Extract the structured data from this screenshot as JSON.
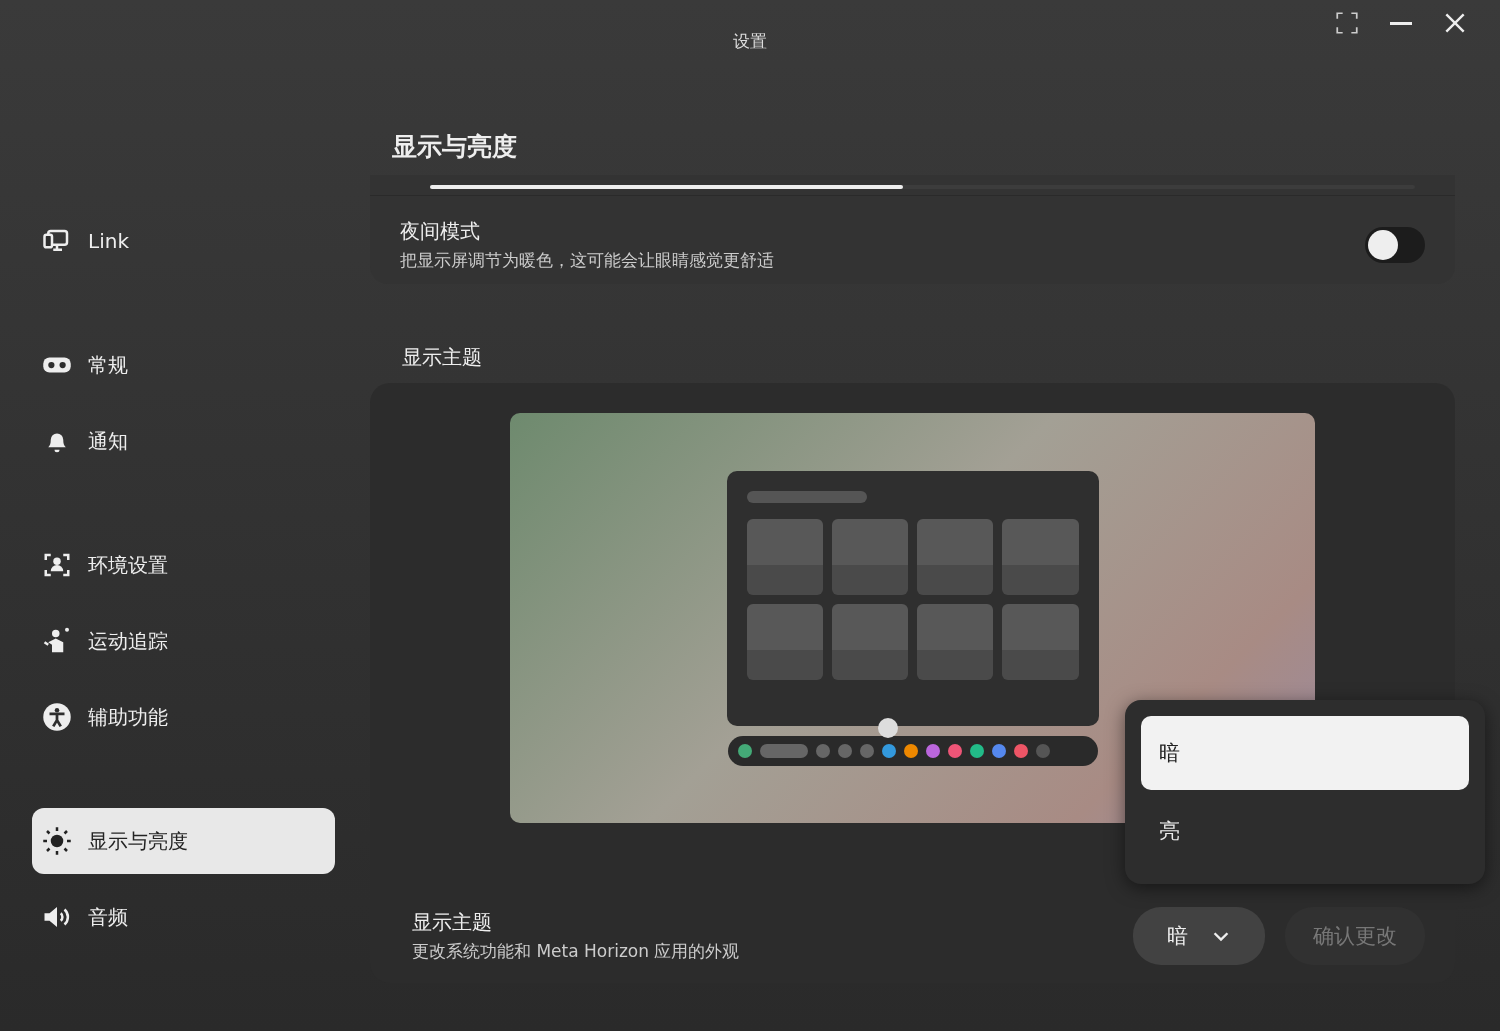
{
  "window": {
    "title": "设置"
  },
  "sidebar": {
    "groups": [
      {
        "items": [
          {
            "label": "Link",
            "selected": false
          }
        ]
      },
      {
        "items": [
          {
            "label": "常规",
            "selected": false
          },
          {
            "label": "通知",
            "selected": false
          }
        ]
      },
      {
        "items": [
          {
            "label": "环境设置",
            "selected": false
          },
          {
            "label": "运动追踪",
            "selected": false
          },
          {
            "label": "辅助功能",
            "selected": false
          }
        ]
      },
      {
        "items": [
          {
            "label": "显示与亮度",
            "selected": true
          },
          {
            "label": "音频",
            "selected": false
          }
        ]
      }
    ]
  },
  "page": {
    "title": "显示与亮度",
    "brightness": {
      "level": 0.48
    },
    "night_mode": {
      "title": "夜间模式",
      "description": "把显示屏调节为暖色，这可能会让眼睛感觉更舒适",
      "on": false
    },
    "theme": {
      "heading": "显示主题",
      "setting": {
        "title": "显示主题",
        "description": "更改系统功能和 Meta Horizon 应用的外观"
      },
      "dropdown": {
        "value": "暗",
        "expanded": true,
        "options": [
          {
            "label": "暗",
            "selected": true
          },
          {
            "label": "亮",
            "selected": false
          }
        ]
      },
      "confirm": {
        "label": "确认更改",
        "disabled": true
      }
    }
  }
}
